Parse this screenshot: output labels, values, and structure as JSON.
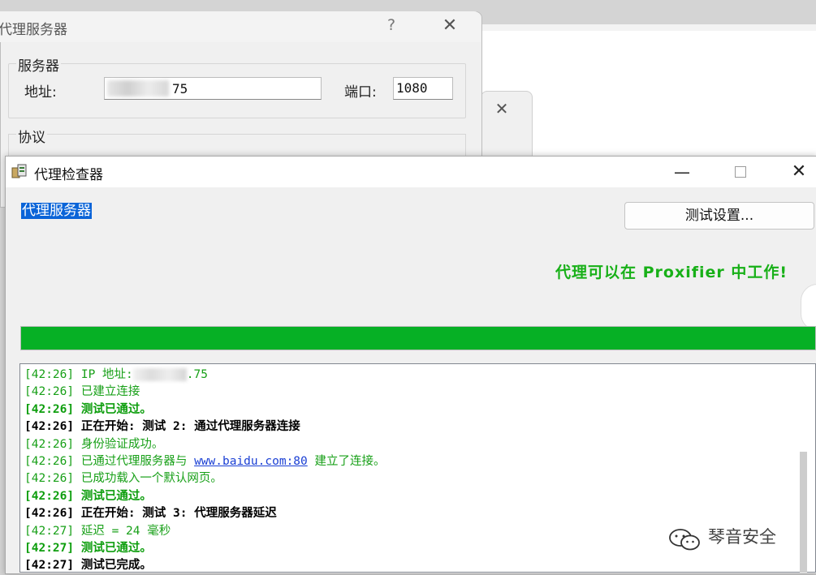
{
  "server_dialog": {
    "title": "代理服务器",
    "help_glyph": "?",
    "close_glyph": "✕",
    "server_group_label": "服务器",
    "address_label": "地址:",
    "address_value_visible": "75",
    "port_label": "端口:",
    "port_value": "1080",
    "protocol_group_label": "协议"
  },
  "middle_dialog": {
    "close_glyph": "✕"
  },
  "checker": {
    "title": "代理检查器",
    "min_glyph": "—",
    "close_glyph": "✕",
    "section_label": "代理服务器",
    "test_settings_button": "测试设置...",
    "success_message": "代理可以在 Proxifier 中工作!",
    "progress_percent": 100,
    "progress_color": "#06b025",
    "log": [
      {
        "style": "green",
        "segments": [
          {
            "t": "[42:26] IP 地址:"
          },
          {
            "mask": true
          },
          {
            "t": ".75"
          }
        ]
      },
      {
        "style": "green",
        "segments": [
          {
            "t": "[42:26] 已建立连接"
          }
        ]
      },
      {
        "style": "greenb",
        "segments": [
          {
            "t": "[42:26] 测试已通过。"
          }
        ]
      },
      {
        "style": "black",
        "segments": [
          {
            "t": "[42:26] 正在开始: 测试 2: 通过代理服务器连接"
          }
        ]
      },
      {
        "style": "green",
        "segments": [
          {
            "t": "[42:26] 身份验证成功。"
          }
        ]
      },
      {
        "style": "green",
        "segments": [
          {
            "t": "[42:26] 已通过代理服务器与 "
          },
          {
            "t": "www.baidu.com:80",
            "link": true
          },
          {
            "t": " 建立了连接。"
          }
        ]
      },
      {
        "style": "green",
        "segments": [
          {
            "t": "[42:26] 已成功载入一个默认网页。"
          }
        ]
      },
      {
        "style": "greenb",
        "segments": [
          {
            "t": "[42:26] 测试已通过。"
          }
        ]
      },
      {
        "style": "black",
        "segments": [
          {
            "t": "[42:26] 正在开始: 测试 3: 代理服务器延迟"
          }
        ]
      },
      {
        "style": "green",
        "segments": [
          {
            "t": "[42:27] 延迟 = 24 毫秒"
          }
        ]
      },
      {
        "style": "greenb",
        "segments": [
          {
            "t": "[42:27] 测试已通过。"
          }
        ]
      },
      {
        "style": "black",
        "segments": [
          {
            "t": "[42:27] 测试已完成。"
          }
        ]
      }
    ]
  },
  "watermark": {
    "text": "琴音安全",
    "icon": "wechat-icon"
  }
}
